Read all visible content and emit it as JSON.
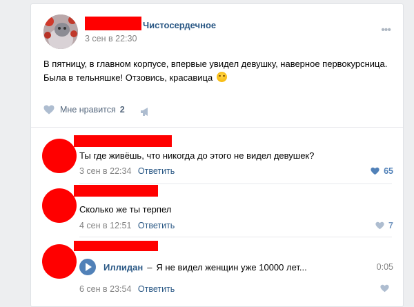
{
  "post": {
    "group_name": "Чистосердечное",
    "date": "3 сен в 22:30",
    "text_line1": "В пятницу, в главном корпусе, впервые увидел девушку, наверное первокурсница.",
    "text_line2": "Была в тельняшке! Отзовись, красавица",
    "more_icon": "more-dots-icon",
    "likes_label": "Мне нравится",
    "likes_count": "2"
  },
  "comments": [
    {
      "text": "Ты где живёшь, что никогда до этого не видел девушек?",
      "date": "3 сен в 22:34",
      "reply_label": "Ответить",
      "likes": "65"
    },
    {
      "text": "Сколько же ты терпел",
      "date": "4 сен в 12:51",
      "reply_label": "Ответить",
      "likes": "7"
    },
    {
      "audio": {
        "artist": "Иллидан",
        "dash": "–",
        "title": "Я не видел женщин уже 10000 лет...",
        "duration": "0:05"
      },
      "date": "6 сен в 23:54",
      "reply_label": "Ответить"
    }
  ],
  "colors": {
    "link": "#2a5885",
    "accent": "#5181b8",
    "redaction": "#ff0000",
    "background": "#edeef0"
  }
}
